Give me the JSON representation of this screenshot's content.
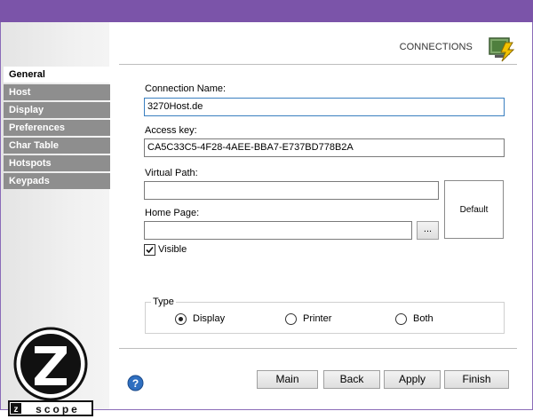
{
  "header": {
    "title": "CONNECTIONS",
    "icon": "connections-icon"
  },
  "sidebar": {
    "items": [
      {
        "label": "General",
        "active": true
      },
      {
        "label": "Host",
        "active": false
      },
      {
        "label": "Display",
        "active": false
      },
      {
        "label": "Preferences",
        "active": false
      },
      {
        "label": "Char Table",
        "active": false
      },
      {
        "label": "Hotspots",
        "active": false
      },
      {
        "label": "Keypads",
        "active": false
      }
    ],
    "logo_text": "z scope"
  },
  "form": {
    "connection_name_label": "Connection Name:",
    "connection_name_value": "3270Host.de",
    "access_key_label": "Access key:",
    "access_key_value": "CA5C33C5-4F28-4AEE-BBA7-E737BD778B2A",
    "virtual_path_label": "Virtual Path:",
    "virtual_path_value": "",
    "home_page_label": "Home Page:",
    "home_page_value": "",
    "browse_label": "...",
    "default_label": "Default",
    "visible_label": "Visible",
    "visible_checked": true
  },
  "type_group": {
    "legend": "Type",
    "options": [
      {
        "label": "Display",
        "selected": true
      },
      {
        "label": "Printer",
        "selected": false
      },
      {
        "label": "Both",
        "selected": false
      }
    ]
  },
  "footer": {
    "main_label": "Main",
    "back_label": "Back",
    "apply_label": "Apply",
    "finish_label": "Finish",
    "help_icon": "help-icon"
  },
  "colors": {
    "titlebar": "#7b54a9",
    "nav_inactive": "#8e8e8e",
    "focus_border": "#3a7fc0"
  }
}
